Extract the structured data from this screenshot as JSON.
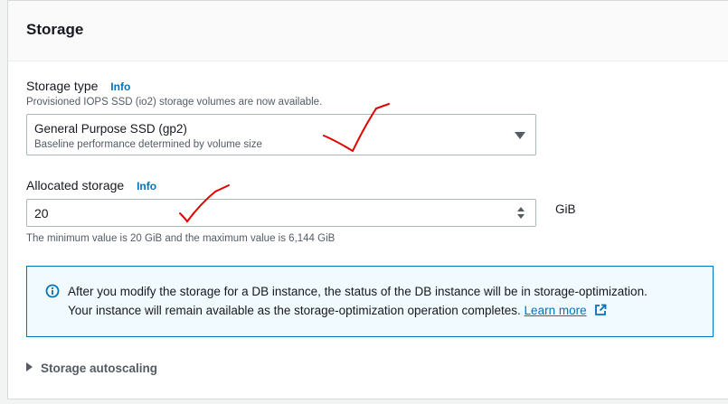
{
  "panel": {
    "title": "Storage"
  },
  "storage_type": {
    "label": "Storage type",
    "info": "Info",
    "notice": "Provisioned IOPS SSD (io2) storage volumes are now available.",
    "selected": "General Purpose SSD (gp2)",
    "selected_description": "Baseline performance determined by volume size"
  },
  "allocated_storage": {
    "label": "Allocated storage",
    "info": "Info",
    "value": "20",
    "unit": "GiB",
    "constraint": "The minimum value is 20 GiB and the maximum value is 6,144 GiB"
  },
  "alert": {
    "line1": "After you modify the storage for a DB instance, the status of the DB instance will be in storage-optimization.",
    "line2": "Your instance will remain available as the storage-optimization operation completes.",
    "link": "Learn more"
  },
  "autoscaling": {
    "label": "Storage autoscaling"
  },
  "colors": {
    "link": "#0073bb",
    "annotation": "#e00000"
  },
  "icons": [
    "select-caret-icon",
    "spinner-icon",
    "info-circle-icon",
    "external-link-icon",
    "expand-caret-icon"
  ]
}
